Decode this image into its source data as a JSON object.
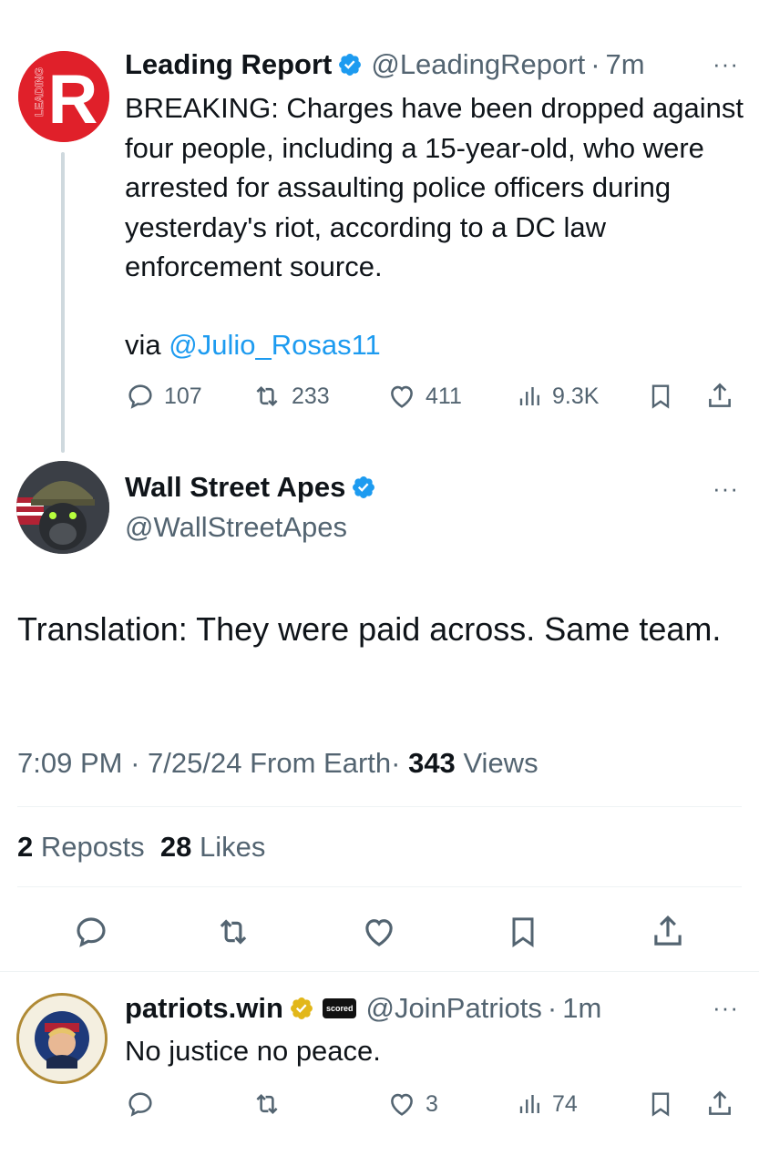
{
  "parent_tweet": {
    "author_name": "Leading Report",
    "handle": "@LeadingReport",
    "time_sep": "·",
    "time": "7m",
    "more": "···",
    "avatar_text": "LEADING",
    "avatar_letter": "R",
    "text": "BREAKING: Charges have been dropped against four people, including a 15-year-old, who were arrested for assaulting police officers during yesterday's riot, according to a DC law enforcement source.",
    "via_label": "via",
    "via_mention": "@Julio_Rosas11",
    "replies": "107",
    "reposts": "233",
    "likes": "411",
    "views": "9.3K"
  },
  "main_tweet": {
    "author_name": "Wall Street Apes",
    "handle": "@WallStreetApes",
    "more": "···",
    "text": "Translation: They were paid across. Same team.",
    "time": "7:09 PM",
    "sep1": "·",
    "date": "7/25/24",
    "source": "From Earth",
    "sep2": "·",
    "views_count": "343",
    "views_label": "Views",
    "reposts_count": "2",
    "reposts_label": "Reposts",
    "likes_count": "28",
    "likes_label": "Likes"
  },
  "reply_tweet": {
    "author_name": "patriots.win",
    "affiliate_badge": "scored",
    "handle": "@JoinPatriots",
    "time_sep": "·",
    "time": "1m",
    "more": "···",
    "text": "No justice no peace.",
    "likes": "3",
    "views": "74"
  },
  "colors": {
    "accent": "#1d9bf0",
    "muted": "#536471",
    "text": "#0f1419",
    "gold_badge": "#e2b719",
    "leading_red": "#e0202a"
  },
  "icons": [
    "reply-icon",
    "repost-icon",
    "like-icon",
    "views-icon",
    "bookmark-icon",
    "share-icon",
    "verified-badge-icon"
  ]
}
